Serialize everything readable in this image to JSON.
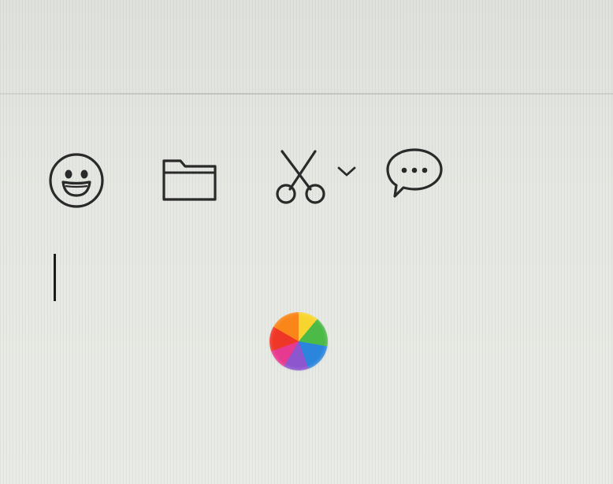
{
  "toolbar": {
    "items": [
      {
        "icon": "emoji-icon",
        "label": ""
      },
      {
        "icon": "attach-file-icon",
        "label": ""
      },
      {
        "icon": "screenshot-scissors-icon",
        "label": ""
      },
      {
        "icon": "chevron-down-icon",
        "label": ""
      },
      {
        "icon": "chat-history-icon",
        "label": ""
      }
    ]
  },
  "compose": {
    "input_value": ""
  },
  "colors": {
    "icon_stroke": "#2a2a2a",
    "caret": "#1b1b1b",
    "background": "#e6e8e3"
  },
  "busy_indicator": "spinning-wheel"
}
